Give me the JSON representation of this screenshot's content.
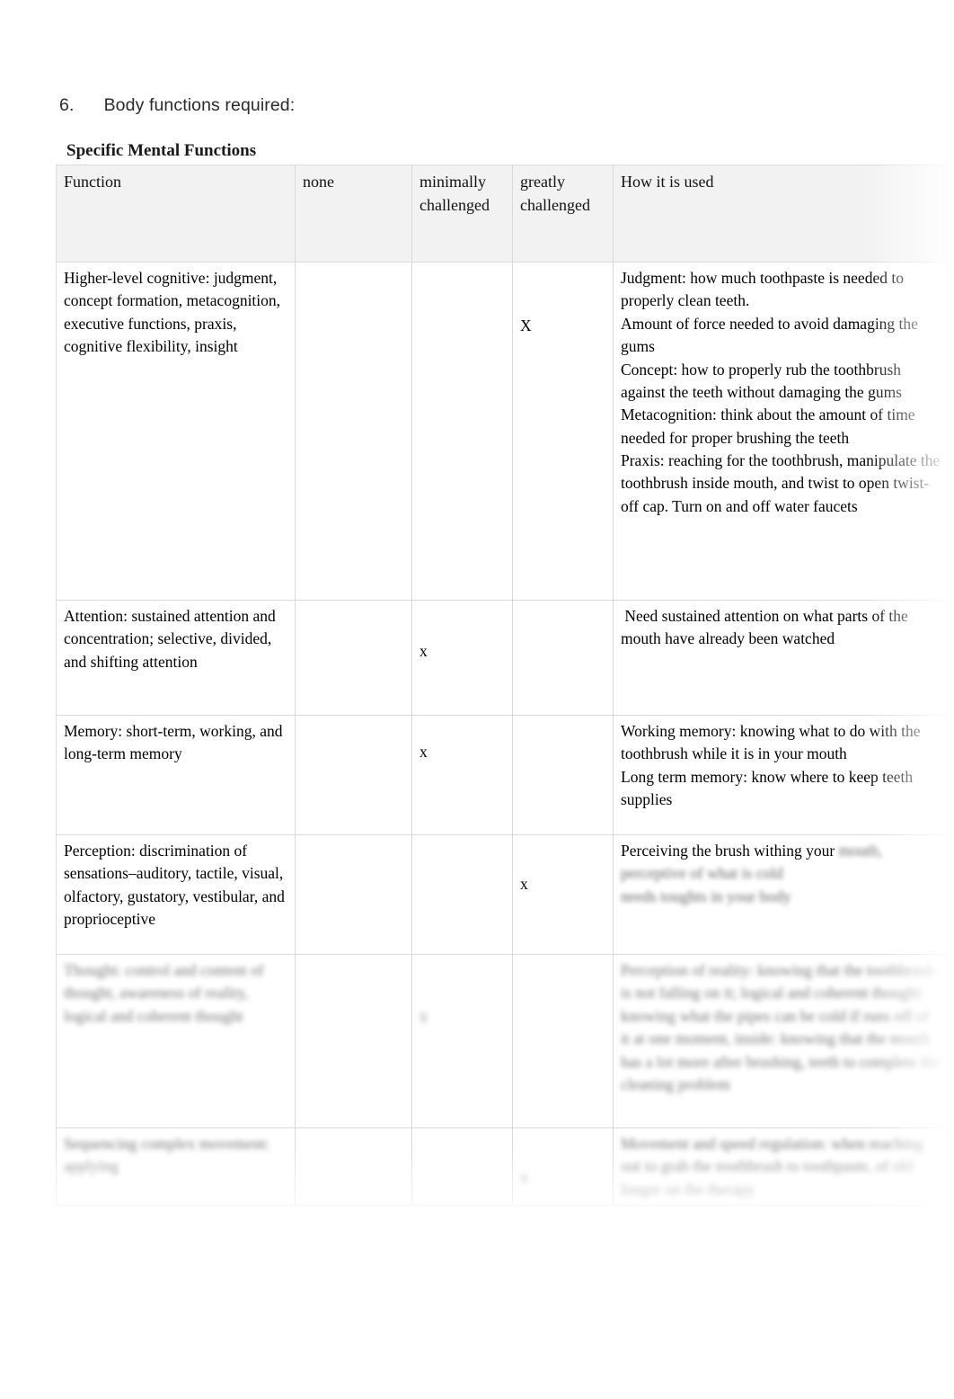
{
  "document": {
    "heading_number": "6.",
    "heading_text": "Body functions required:",
    "section_title": "Specific Mental Functions"
  },
  "table": {
    "headers": {
      "function": "Function",
      "none": "none",
      "minimally_challenged": "minimally challenged",
      "greatly_challenged": "greatly challenged",
      "how_it_is_used": "How it is used"
    },
    "rows": [
      {
        "function": "Higher-level cognitive: judgment, concept formation, metacognition, executive functions, praxis, cognitive flexibility, insight",
        "none": "",
        "minimally_challenged": "",
        "greatly_challenged": "X",
        "how_it_is_used": "Judgment: how much toothpaste is needed to properly clean teeth.\nAmount of force needed to avoid damaging the gums\nConcept: how to properly rub the toothbrush against the teeth without damaging the gums\nMetacognition: think about the amount of time needed for proper brushing the teeth\nPraxis: reaching for the toothbrush, manipulate the toothbrush inside mouth, and twist to open twist-off cap. Turn on and off water faucets",
        "legible": true
      },
      {
        "function": "Attention: sustained attention and concentration; selective, divided, and shifting attention",
        "none": "",
        "minimally_challenged": "x",
        "greatly_challenged": "",
        "how_it_is_used": " Need sustained attention on what parts of the mouth have already been watched",
        "legible": true
      },
      {
        "function": "Memory: short-term, working, and long-term memory",
        "none": "",
        "minimally_challenged": "x",
        "greatly_challenged": "",
        "how_it_is_used": "Working memory: knowing what to do with the toothbrush while it is in your mouth\nLong term memory: know where to keep teeth supplies",
        "legible": true
      },
      {
        "function": "Perception: discrimination of sensations–auditory, tactile, visual, olfactory, gustatory, vestibular, and proprioceptive",
        "none": "",
        "minimally_challenged": "",
        "greatly_challenged": "x",
        "how_it_is_used_visible": "Perceiving the brush withing your",
        "how_it_is_used_blurred": "mouth, perceptive of what is cold\nneeds toughts in your body",
        "legible": "partial"
      },
      {
        "function": "Thought: control and content of thought, awareness of reality, logical and coherent thought",
        "none": "",
        "minimally_challenged": "x",
        "greatly_challenged": "",
        "how_it_is_used": "Perception of reality: knowing that the toothbrush is not falling on it; logical and coherent thought: knowing what the pipes can be cold if runs off of it at one moment, inside: knowing that the mouth has a lot more after brushing, teeth to complete the cleaning problem",
        "legible": false
      },
      {
        "function": "Sequencing complex movement: applying",
        "none": "",
        "minimally_challenged": "",
        "greatly_challenged": "x",
        "how_it_is_used": "Movement and speed regulation: when reaching out to grab the toothbrush to toothpaste, of old longer on the therapy",
        "legible": false
      }
    ]
  }
}
